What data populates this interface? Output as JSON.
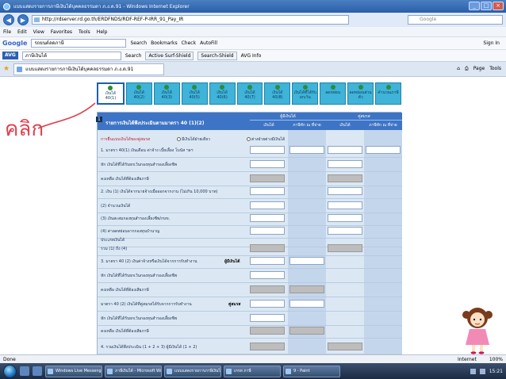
{
  "window": {
    "title": "แบบแสดงรายการภาษีเงินได้บุคคลธรรมดา ภ.ง.ด.91 - Windows Internet Explorer",
    "url": "http://rdserver.rd.go.th/ERDFNDS/RDF-REF-P-IRR_91_Pay_IR",
    "search_placeholder": "Google"
  },
  "menu": [
    "File",
    "Edit",
    "View",
    "Favorites",
    "Tools",
    "Help"
  ],
  "google_toolbar": {
    "logo": "Google",
    "search_value": "รถยนต์ลดภาษี",
    "items": [
      "Search",
      "Bookmarks",
      "Check",
      "AutoFill",
      "Sign In"
    ]
  },
  "avg_toolbar": {
    "logo": "AVG",
    "search_value": "ภาษีเงินได้",
    "items": [
      "Search",
      "Active Surf-Shield",
      "Search-Shield",
      "AVG Info"
    ]
  },
  "tab": {
    "title": "แบบแสดงรายการภาษีเงินได้บุคคลธรรมดา ภ.ง.ด.91",
    "tools": [
      "Page",
      "Tools"
    ]
  },
  "form_tabs": [
    {
      "line1": "เงินได้",
      "line2": "40(1)",
      "active": true
    },
    {
      "line1": "เงินได้",
      "line2": "40(2)",
      "active": false
    },
    {
      "line1": "เงินได้",
      "line2": "40(3)",
      "active": false
    },
    {
      "line1": "เงินได้",
      "line2": "40(5)",
      "active": false
    },
    {
      "line1": "เงินได้",
      "line2": "40(6)",
      "active": false
    },
    {
      "line1": "เงินได้",
      "line2": "40(7)",
      "active": false
    },
    {
      "line1": "เงินได้",
      "line2": "40(8)",
      "active": false
    },
    {
      "line1": "เงินได้ที่ได้รับยกเว้น",
      "line2": "",
      "active": false
    },
    {
      "line1": "ลดหย่อน",
      "line2": "",
      "active": false
    },
    {
      "line1": "ลดหย่อนส่วนตัว",
      "line2": "",
      "active": false
    },
    {
      "line1": "คำนวณภาษี",
      "line2": "",
      "active": false
    }
  ],
  "annotation": {
    "click_label": "คลิก"
  },
  "form": {
    "number": "1",
    "title": "รายการเงินได้พึงประเมินตามมาตรา 40 (1)(2)",
    "group_taxpayer": "ผู้มีเงินได้",
    "group_spouse": "คู่สมรส",
    "col_income": "เงินได้",
    "col_withheld": "ภาษีหัก ณ ที่จ่าย",
    "col_income_spouse": "เงินได้",
    "col_withheld_spouse": "ภาษีหัก ณ ที่จ่าย",
    "option_label": "การยื่นแบบเงินได้ของคู่สมรส",
    "option_a": "มีเงินได้ฝ่ายเดียว",
    "option_b": "ต่างฝ่ายต่างมีเงินได้",
    "rows": [
      {
        "text": "1. มาตรา 40(1) เงินเดือน ค่าจ้าง เบี้ยเลี้ยง โบนัส ฯลฯ"
      },
      {
        "text": "หัก เงินได้ที่ได้รับยกเว้นกองทุนสำรองเลี้ยงชีพ"
      },
      {
        "text": "คงเหลือ เงินได้ที่ต้องเสียภาษี"
      },
      {
        "text": "2. เงิน (1) เงินได้จากนายจ้างเมื่อออกจากงาน (ไม่เกิน 10,000 บาท)"
      },
      {
        "text": "(2) จำนวนเงินได้"
      },
      {
        "text": "(3) เงินสะสมกองทุนสำรองเลี้ยงชีพ/กบข."
      },
      {
        "text": "(4) ค่าลดหย่อนจากกองทุนบำนาญ"
      },
      {
        "text": "ประเภทเงินได้"
      },
      {
        "text": "รวม (1) ถึง (4)"
      },
      {
        "text": "3. มาตรา 40 (2) เงินค่าจ้างหรือเงินได้จากการรับทำงาน"
      },
      {
        "text": "หัก เงินได้ที่ได้รับยกเว้นกองทุนสำรองเลี้ยงชีพ"
      },
      {
        "text": "คงเหลือ เงินได้ที่ต้องเสียภาษี"
      },
      {
        "text": "มาตรา 40 (2) เงินได้ที่คู่สมรสได้รับจากการรับทำงาน"
      },
      {
        "text": "หัก เงินได้ที่ได้รับยกเว้นกองทุนสำรองเลี้ยงชีพ"
      },
      {
        "text": "คงเหลือ เงินได้ที่ต้องเสียภาษี"
      },
      {
        "text": "4. รวมเงินได้พึงประเมิน (1 + 2 + 3) ผู้มีเงินได้ (1 + 2)"
      }
    ],
    "inline_taxpayer": "ผู้มีเงินได้",
    "inline_spouse": "คู่สมรส"
  },
  "status": {
    "text": "Done",
    "zone": "Internet",
    "zoom": "100%"
  },
  "taskbar": {
    "tasks": [
      "Windows Live Messenger",
      "ภาษีเงินได้ - Microsoft Word",
      "แบบแสดงรายการภาษีเงินได้",
      "เกรท ภาษี",
      "9 - Paint"
    ],
    "clock": "15:21"
  }
}
